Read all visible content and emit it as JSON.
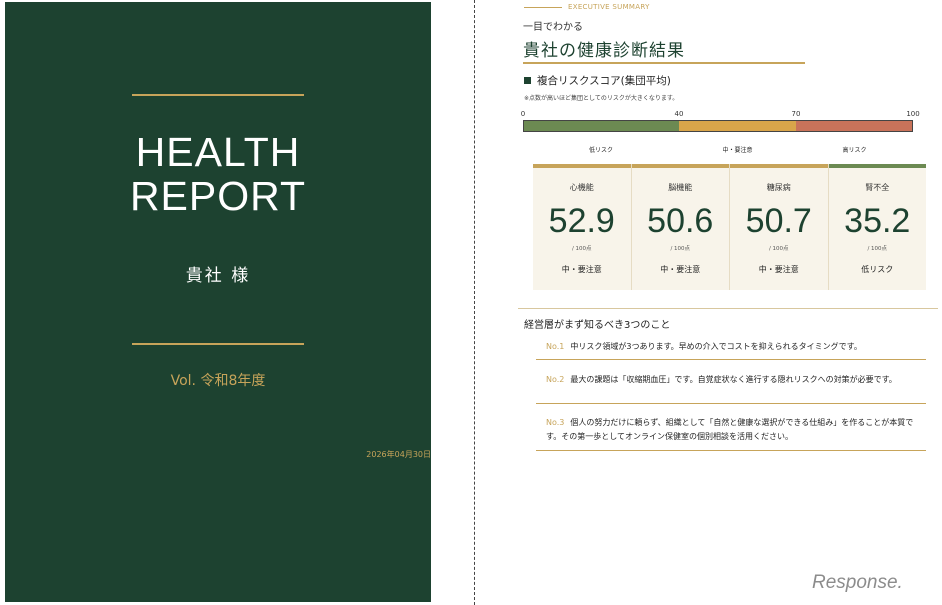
{
  "cover": {
    "title_line1": "HEALTH",
    "title_line2": "REPORT",
    "client": "貴社 様",
    "volume": "Vol.  令和8年度",
    "date": "2026年04月30日"
  },
  "summary": {
    "eyebrow": "EXECUTIVE SUMMARY",
    "subhead": "一目でわかる",
    "heading": "貴社の健康診断結果",
    "section_title": "複合リスクスコア(集団平均)",
    "note": "※点数が高いほど集団としてのリスクが大きくなります。",
    "scale": {
      "min": 0,
      "max": 100,
      "ticks": [
        "0",
        "40",
        "70",
        "100"
      ],
      "segments": [
        {
          "from": 0,
          "to": 40,
          "label": "低リスク",
          "color": "#6c8a52"
        },
        {
          "from": 40,
          "to": 70,
          "label": "中・要注意",
          "color": "#d9a54a"
        },
        {
          "from": 70,
          "to": 100,
          "label": "高リスク",
          "color": "#c9735a"
        }
      ]
    },
    "scores": [
      {
        "name": "心機能",
        "value": "52.9",
        "unit": "/ 100点",
        "level": "中・要注意"
      },
      {
        "name": "脳機能",
        "value": "50.6",
        "unit": "/ 100点",
        "level": "中・要注意"
      },
      {
        "name": "糖尿病",
        "value": "50.7",
        "unit": "/ 100点",
        "level": "中・要注意"
      },
      {
        "name": "腎不全",
        "value": "35.2",
        "unit": "/ 100点",
        "level": "低リスク"
      }
    ],
    "points_title": "経営層がまず知るべき3つのこと",
    "points": [
      {
        "no": "No.1",
        "text": "中リスク領域が3つあります。早めの介入でコストを抑えられるタイミングです。"
      },
      {
        "no": "No.2",
        "text": "最大の課題は「収縮期血圧」です。自覚症状なく進行する隠れリスクへの対策が必要です。"
      },
      {
        "no": "No.3",
        "text": "個人の努力だけに頼らず、組織として「自然と健康な選択ができる仕組み」を作ることが本質です。その第一歩としてオンライン保健室の個別相談を活用ください。"
      }
    ]
  },
  "watermark": "Response."
}
